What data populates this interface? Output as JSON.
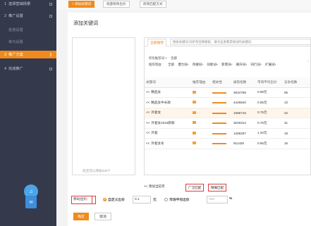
{
  "sidebar": {
    "items": [
      {
        "num": "1",
        "label": "选择营销场景",
        "type": "main"
      },
      {
        "num": "2",
        "label": "推广设置",
        "type": "main"
      },
      {
        "num": "",
        "label": "投放设置",
        "type": "sub"
      },
      {
        "num": "",
        "label": "单元设置",
        "type": "sub"
      },
      {
        "num": "3",
        "label": "推广方案",
        "type": "active"
      },
      {
        "num": "4",
        "label": "完成推广",
        "type": "main"
      }
    ],
    "widget_icon": "bell-icon",
    "widget_box_icon": "mail-icon"
  },
  "toolbar": {
    "add_keyword": "+ 添加关键词",
    "batch_bid": "批量修改出价",
    "match_mode": "修改匹配方式"
  },
  "modal": {
    "title": "添加关键词",
    "left_hint": "您还可以添加200个",
    "tabs": {
      "all": "全部推荐",
      "search_placeholder": "搜索关键词  同步淘宝网搜索，请点击查看其他词的关键词"
    },
    "filters": {
      "row1_label": "所有推荐词 >",
      "row1_value": "全部",
      "row2_label": "推荐理由：",
      "row2_options": [
        "全部",
        "潜力词",
        "热搜词",
        "同款词",
        "新增词",
        "飙升词",
        "同行词",
        "扩展词"
      ]
    },
    "table": {
      "headers": [
        "关键词",
        "推荐理由",
        "相关性",
        "展现指数",
        "市场平均出价",
        "竞争指数"
      ],
      "rows": [
        {
          "add": "<<",
          "keyword": "精品女",
          "rec": "荐",
          "impr": "3634788",
          "bid": "0.88元",
          "comp": "95"
        },
        {
          "add": "<<",
          "keyword": "精品女中长款",
          "rec": "荐",
          "impr": "4446840",
          "bid": "0.95元",
          "comp": "10"
        },
        {
          "add": "<<",
          "keyword": "外套女",
          "rec": "荐",
          "impr": "1685715",
          "bid": "0.75元",
          "comp": "22"
        },
        {
          "add": "<<",
          "keyword": "外套女2019新款",
          "rec": "荐",
          "impr": "3049312",
          "bid": "0.76元",
          "comp": "31"
        },
        {
          "add": "<<",
          "keyword": "外套",
          "rec": "荐",
          "impr": "1288297",
          "bid": "1.20元",
          "comp": "18"
        },
        {
          "add": "<<",
          "keyword": "外套女冬",
          "rec": "荐",
          "impr": "911428",
          "bid": "0.86元",
          "comp": "15"
        }
      ]
    },
    "footer": {
      "add_current": "<< 添加当前页",
      "broad_match": "广泛匹配",
      "exact_match": "精确匹配"
    },
    "bid_computer": {
      "label": "计算机出价：",
      "custom": "自定义出价",
      "value": "0.1",
      "unit": "元",
      "market": "市场平均出价",
      "pct": "100",
      "pct_unit": "%"
    },
    "bid_mobile": {
      "label": "移动出价：",
      "custom": "自定义出价",
      "value": "0.1",
      "unit": "元",
      "market": "市场平均出价",
      "pct": "100",
      "pct_unit": "%"
    },
    "ok": "确定",
    "cancel": "取消"
  }
}
